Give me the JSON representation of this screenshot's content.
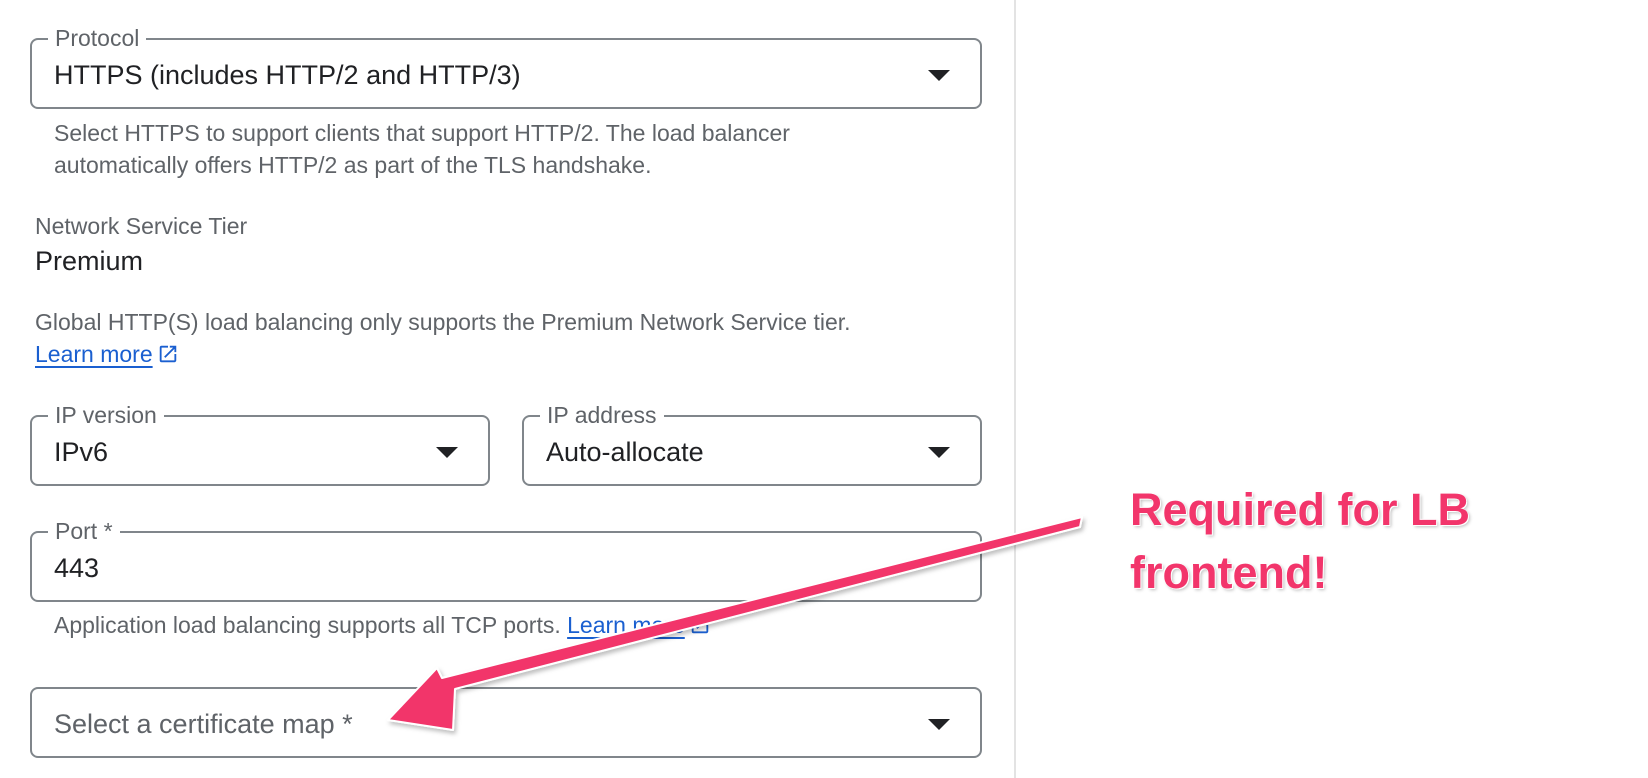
{
  "protocol": {
    "label": "Protocol",
    "value": "HTTPS (includes HTTP/2 and HTTP/3)",
    "hint_line1": "Select HTTPS to support clients that support HTTP/2. The load balancer",
    "hint_line2": "automatically offers HTTP/2 as part of the TLS handshake."
  },
  "network_tier": {
    "label": "Network Service Tier",
    "value": "Premium",
    "hint": "Global HTTP(S) load balancing only supports the Premium Network Service tier.",
    "learn_more": "Learn more"
  },
  "ip_version": {
    "label": "IP version",
    "value": "IPv6"
  },
  "ip_address": {
    "label": "IP address",
    "value": "Auto-allocate"
  },
  "port": {
    "label": "Port *",
    "value": "443",
    "hint": "Application load balancing supports all TCP ports.",
    "learn_more": "Learn more"
  },
  "certificate_map": {
    "placeholder": "Select a certificate map *"
  },
  "annotation": {
    "line1": "Required for LB",
    "line2": "frontend!",
    "color": "#f2356b"
  },
  "colors": {
    "link": "#1a5fd0",
    "border": "#80868b",
    "secondary_text": "#5f6368"
  },
  "icons": {
    "dropdown": "arrow-drop-down-icon",
    "external_link": "open-in-new-icon"
  }
}
